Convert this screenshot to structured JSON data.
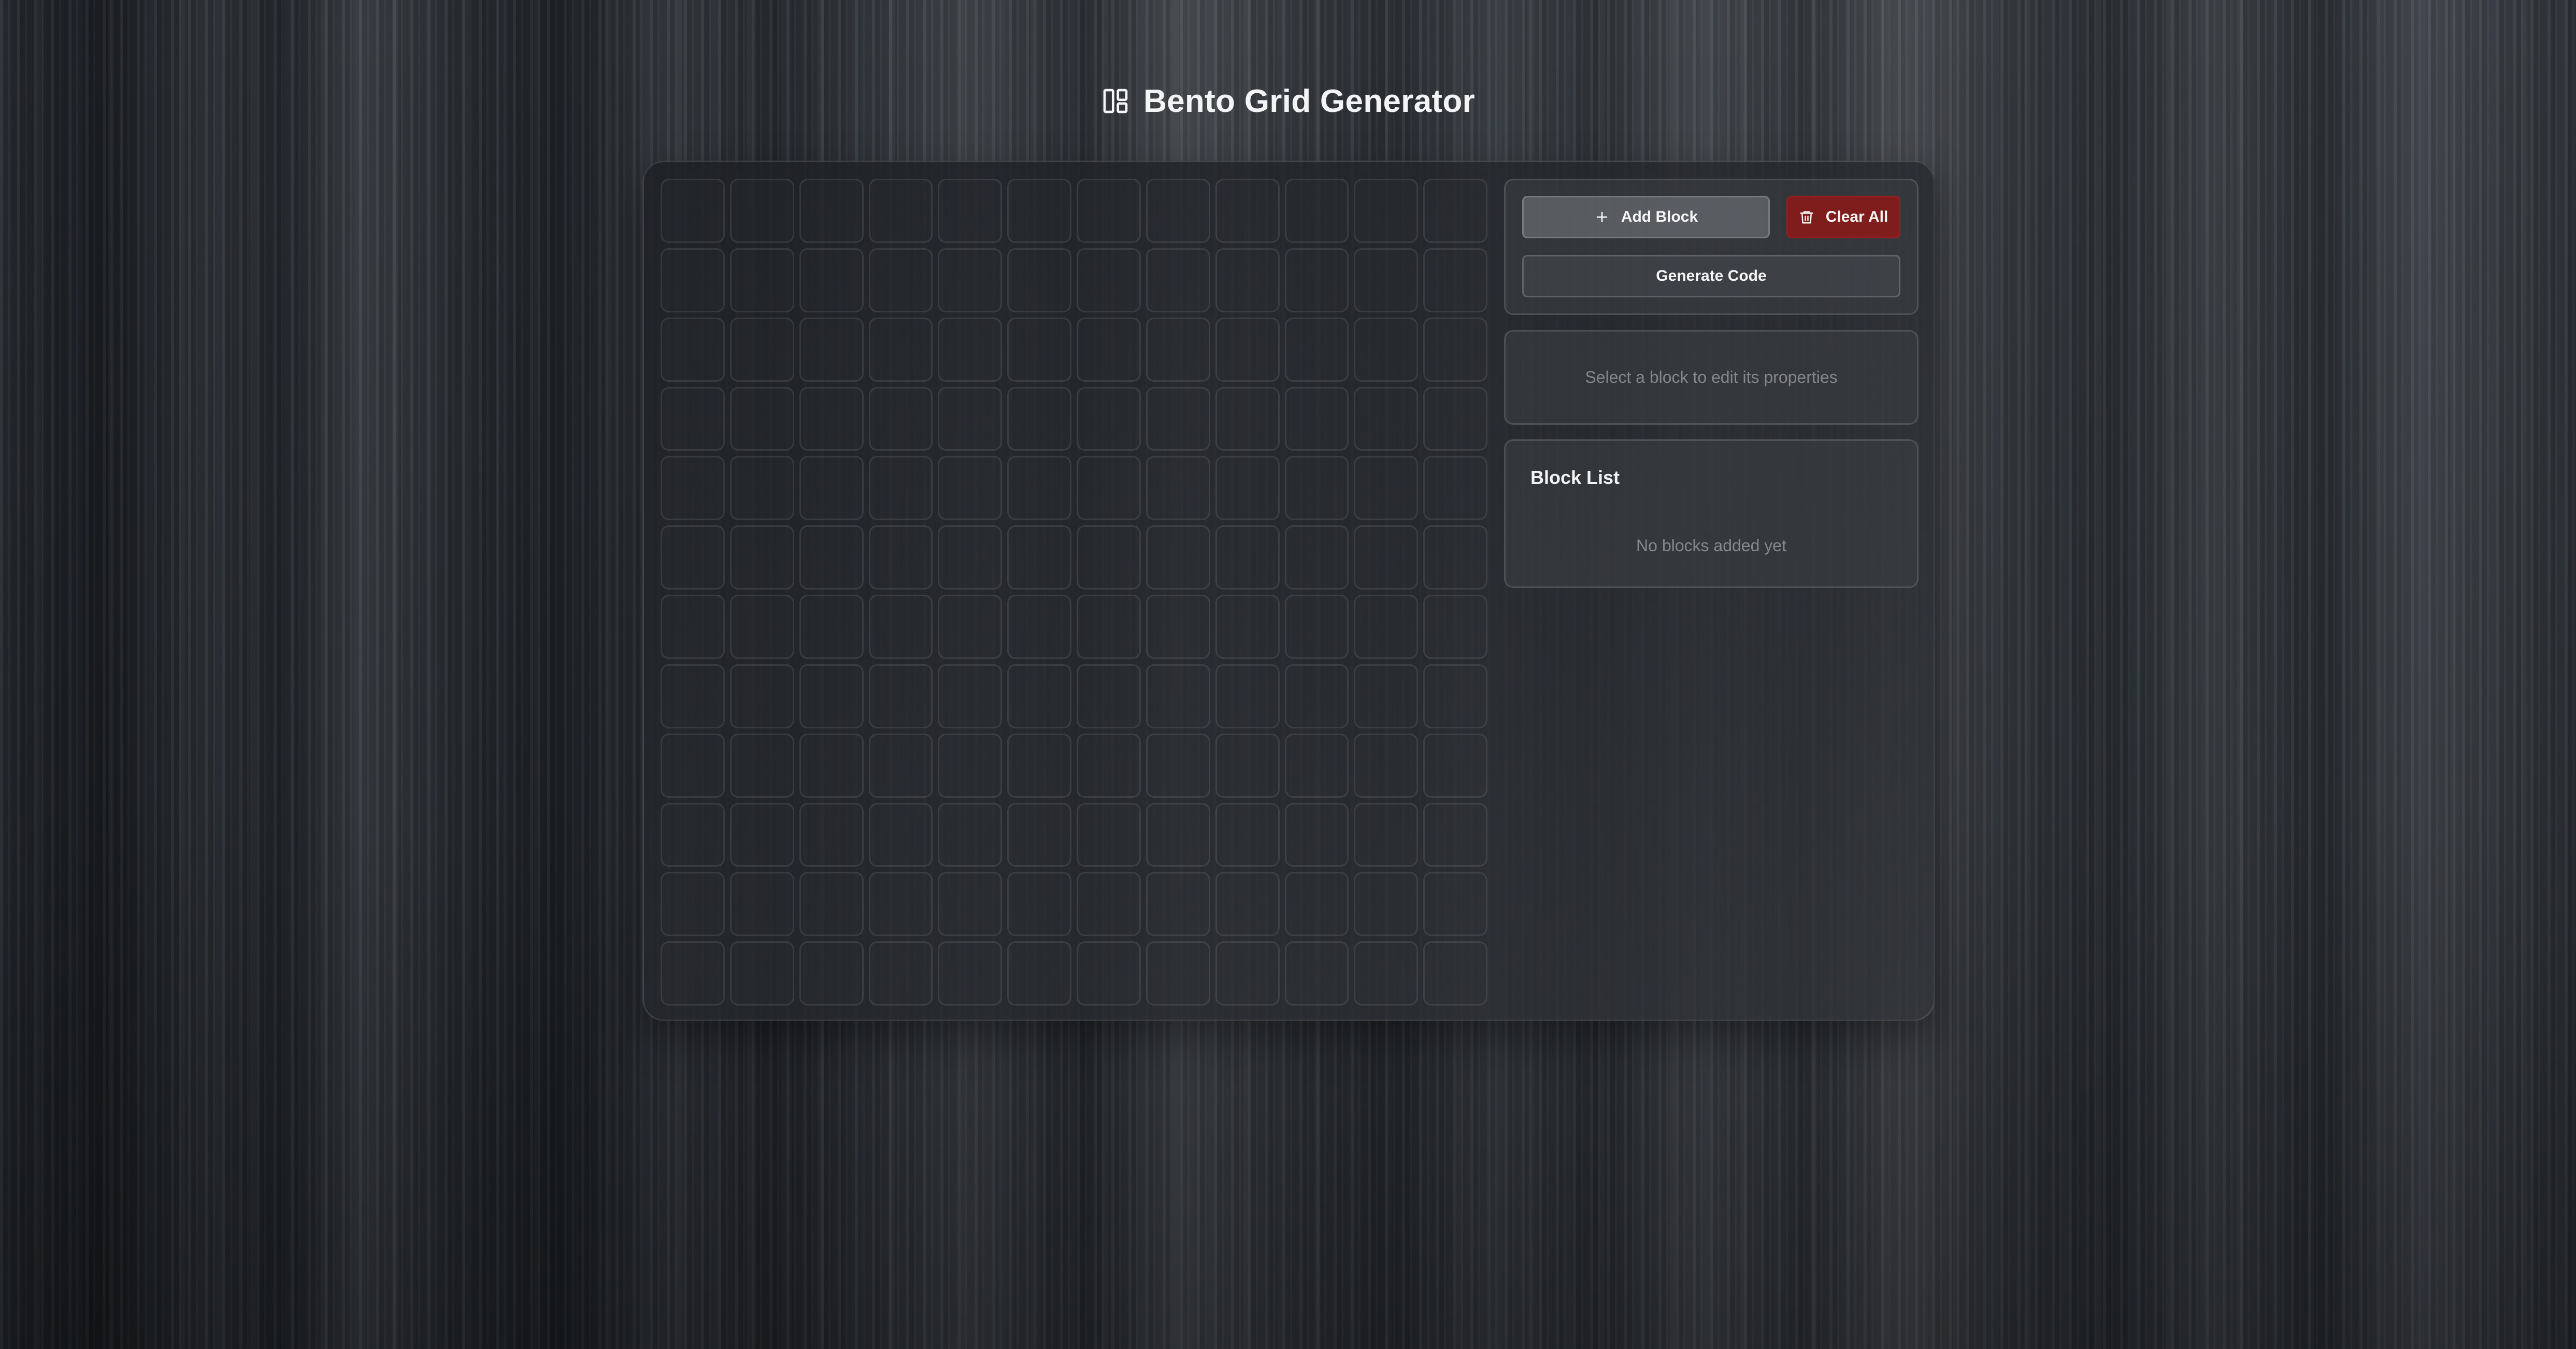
{
  "header": {
    "title": "Bento Grid Generator",
    "logo_icon": "layout-dashboard-icon"
  },
  "grid": {
    "columns": 12,
    "rows": 12,
    "blocks": []
  },
  "controls": {
    "add_block_label": "Add Block",
    "add_block_icon": "plus-icon",
    "clear_all_label": "Clear All",
    "clear_all_icon": "trash-icon",
    "generate_code_label": "Generate Code"
  },
  "properties": {
    "empty_hint": "Select a block to edit its properties"
  },
  "block_list": {
    "title": "Block List",
    "empty_text": "No blocks added yet"
  },
  "colors": {
    "danger": "#7f1d1d",
    "text_primary": "#f3f4f6",
    "text_muted": "#8c9096"
  }
}
